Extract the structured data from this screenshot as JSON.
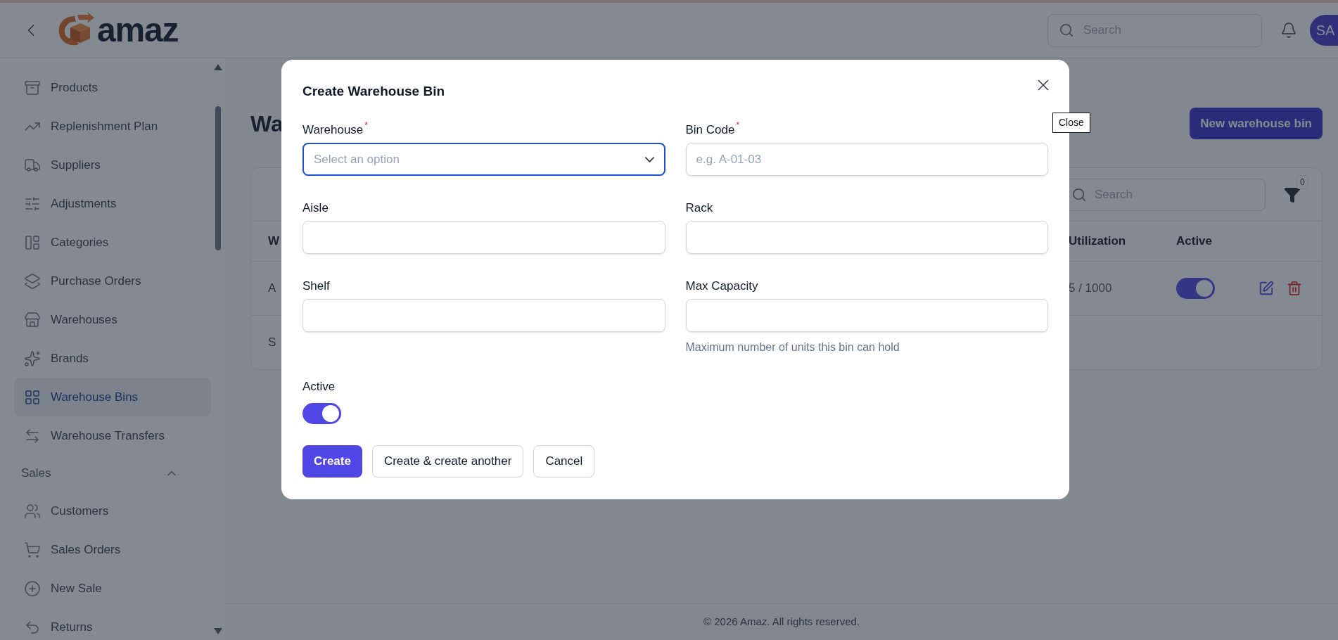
{
  "header": {
    "logo_text": "amaz",
    "search_placeholder": "Search",
    "avatar_initials": "SA"
  },
  "sidebar": {
    "items": [
      {
        "label": "Products",
        "selected": false
      },
      {
        "label": "Replenishment Plan",
        "selected": false
      },
      {
        "label": "Suppliers",
        "selected": false
      },
      {
        "label": "Adjustments",
        "selected": false
      },
      {
        "label": "Categories",
        "selected": false
      },
      {
        "label": "Purchase Orders",
        "selected": false
      },
      {
        "label": "Warehouses",
        "selected": false
      },
      {
        "label": "Brands",
        "selected": false
      },
      {
        "label": "Warehouse Bins",
        "selected": true
      },
      {
        "label": "Warehouse Transfers",
        "selected": false
      }
    ],
    "sections": [
      {
        "label": "Sales",
        "expanded": true,
        "items": [
          {
            "label": "Customers",
            "selected": false
          },
          {
            "label": "Sales Orders",
            "selected": false
          },
          {
            "label": "New Sale",
            "selected": false
          },
          {
            "label": "Returns",
            "selected": false
          }
        ]
      }
    ]
  },
  "page": {
    "title": "Wa",
    "new_button": "New warehouse bin",
    "table": {
      "search_placeholder": "Search",
      "filter_count": "0",
      "columns": [
        "W",
        "Utilization",
        "Active"
      ],
      "rows": [
        {
          "column_1": "A",
          "utilization": "5 / 1000",
          "active": true
        }
      ],
      "footer_text": "S"
    }
  },
  "footer": "© 2026 Amaz. All rights reserved.",
  "modal": {
    "title": "Create Warehouse Bin",
    "close_tooltip": "Close",
    "fields": [
      {
        "kind": "select",
        "label": "Warehouse",
        "required_mark": "*",
        "placeholder": "Select an option",
        "focused": true
      },
      {
        "kind": "text",
        "label": "Bin Code",
        "required_mark": "*",
        "placeholder": "e.g. A-01-03",
        "focused": false
      },
      {
        "kind": "text",
        "label": "Aisle",
        "focused": false
      },
      {
        "kind": "text",
        "label": "Rack",
        "focused": false
      },
      {
        "kind": "text",
        "label": "Shelf",
        "focused": false
      },
      {
        "kind": "text",
        "label": "Max Capacity",
        "focused": false,
        "helper": "Maximum number of units this bin can hold"
      }
    ],
    "active": {
      "label": "Active",
      "on": true
    },
    "buttons": [
      {
        "label": "Create",
        "kind": "primary"
      },
      {
        "label": "Create & create another",
        "kind": "secondary"
      },
      {
        "label": "Cancel",
        "kind": "secondary"
      }
    ]
  }
}
